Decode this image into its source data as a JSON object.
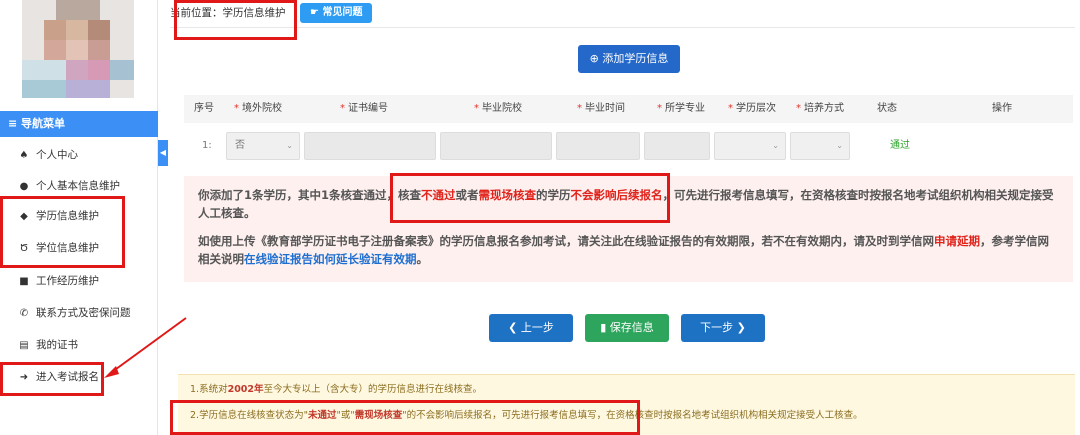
{
  "breadcrumb": "当前位置：学历信息维护",
  "faq_button": "常见问题",
  "add_button": "添加学历信息",
  "sidebar": {
    "nav_header": "导航菜单",
    "items": [
      {
        "label": "个人中心",
        "icon": "home-icon"
      },
      {
        "label": "个人基本信息维护",
        "icon": "user-icon"
      },
      {
        "label": "学历信息维护",
        "icon": "graduation-cap-icon"
      },
      {
        "label": "学位信息维护",
        "icon": "degree-icon"
      },
      {
        "label": "工作经历维护",
        "icon": "briefcase-icon"
      },
      {
        "label": "联系方式及密保问题",
        "icon": "phone-icon"
      },
      {
        "label": "我的证书",
        "icon": "certificate-icon"
      },
      {
        "label": "进入考试报名",
        "icon": "arrow-circle-icon"
      }
    ]
  },
  "table": {
    "headers": [
      {
        "label": "序号",
        "required": false
      },
      {
        "label": "境外院校",
        "required": true
      },
      {
        "label": "证书编号",
        "required": true
      },
      {
        "label": "毕业院校",
        "required": true
      },
      {
        "label": "毕业时间",
        "required": true
      },
      {
        "label": "所学专业",
        "required": true
      },
      {
        "label": "学历层次",
        "required": true
      },
      {
        "label": "培养方式",
        "required": true
      },
      {
        "label": "状态",
        "required": false
      },
      {
        "label": "操作",
        "required": false
      }
    ],
    "row": {
      "index": "1:",
      "overseas": "否",
      "status": "通过"
    }
  },
  "notice": {
    "p1_a": "你添加了1条学历，其中1条核查通过，核查",
    "p1_b": "不通过",
    "p1_c": "或者",
    "p1_d": "需现场核查",
    "p1_e": "的学历",
    "p1_f": "不会影响后续报名",
    "p1_g": "，可先进行报考信息填写，在资格核查时按报名地考试组织机构相关规定接受人工核查。",
    "p2_a": "如使用上传《教育部学历证书电子注册备案表》的学历信息报名参加考试，请关注此在线验证报告的有效期限，若不在有效期内，请及时到学信网",
    "p2_b": "申请延期",
    "p2_c": "，参考学信网相关说明",
    "p2_d": "在线验证报告如何延长验证有效期",
    "p2_e": "。"
  },
  "buttons": {
    "prev": "上一步",
    "save": "保存信息",
    "next": "下一步"
  },
  "tips": {
    "t1_a": "1.系统对",
    "t1_b": "2002年",
    "t1_c": "至今大专以上（含大专）的学历信息进行在线核查。",
    "t2_a": "2.学历信息在线核查状态为\"",
    "t2_b": "未通过",
    "t2_c": "\"或\"",
    "t2_d": "需现场核查",
    "t2_e": "\"的不会影响后续报名，可先进行报考信息填写，在资格核查时按报名地考试组织机构相关规定接受人工核查。"
  },
  "colors": {
    "accent": "#3b8ff5",
    "annotation": "#e01818",
    "pass": "#2aa32a"
  }
}
